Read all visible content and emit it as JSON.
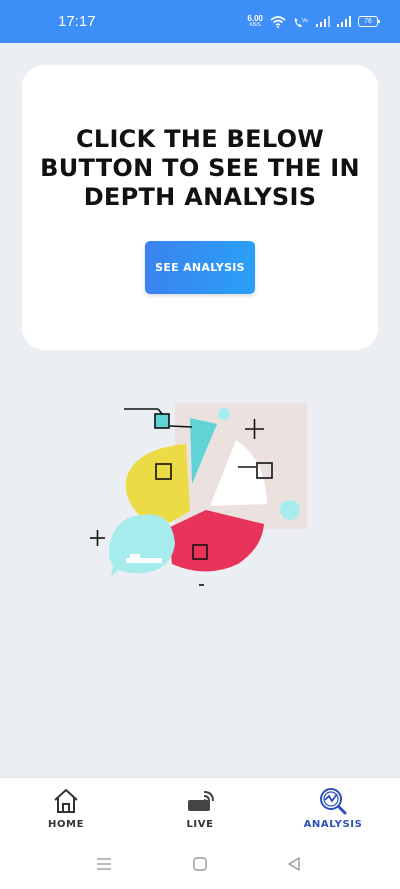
{
  "status_bar": {
    "time": "17:17",
    "net_speed_value": "6.00",
    "net_speed_unit": "KB/S",
    "battery": "76"
  },
  "card": {
    "title": "CLICK THE BELOW BUTTON TO SEE THE IN DEPTH ANALYSIS",
    "button_label": "SEE ANALYSIS"
  },
  "illustration": {
    "icon": "pie-chart-illustration",
    "colors": {
      "yellow": "#ecdb45",
      "red": "#e8345a",
      "cyan": "#5fd3d6",
      "white": "#ffffff",
      "beige": "#ebe2e0",
      "light_cyan": "#a6ecec"
    }
  },
  "bottom_nav": {
    "items": [
      {
        "label": "HOME",
        "icon": "home-icon"
      },
      {
        "label": "LIVE",
        "icon": "live-icon"
      },
      {
        "label": "ANALYSIS",
        "icon": "analysis-icon",
        "active": true
      }
    ]
  },
  "colors": {
    "status_bar": "#3d8ef7",
    "background": "#ebeff3",
    "button_start": "#3b82f0",
    "button_end": "#2aa0f7",
    "active_nav": "#2c50b8"
  }
}
